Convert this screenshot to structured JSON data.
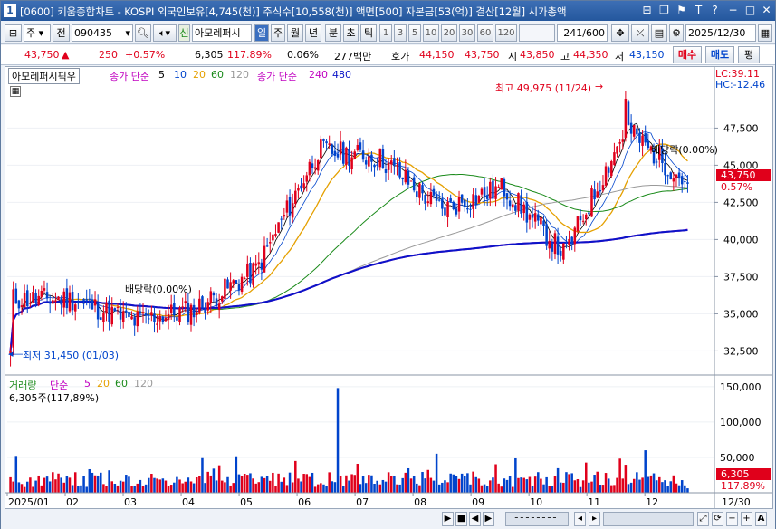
{
  "titlebar": {
    "window_number": "1",
    "title": "[0600] 키움종합차트 - KOSPI 외국인보유[4,745(천)] 주식수[10,558(천)] 액면[500] 자본금[53(억)] 결산[12월] 시가총액",
    "controls": [
      "⊟",
      "❐",
      "⚑",
      "T",
      "?",
      "−",
      "□",
      "✕"
    ]
  },
  "toolbar": {
    "market": "주",
    "all": "전",
    "code": "090435",
    "new_label": "신",
    "stock_name": "아모레퍼시",
    "period_tabs": [
      "일",
      "주",
      "월",
      "년",
      "분",
      "초",
      "틱"
    ],
    "active_period": "일",
    "intervals": [
      "1",
      "3",
      "5",
      "10",
      "20",
      "30",
      "60",
      "120"
    ],
    "count": "241",
    "count_total": "/600",
    "date": "2025/12/30"
  },
  "quote": {
    "price": "43,750",
    "arrow": "▲",
    "change": "250",
    "change_pct": "+0.57%",
    "volume": "6,305",
    "volume_ratio": "117.89%",
    "turnover": "0.06%",
    "amount": "277백만",
    "ask_label": "호가",
    "ask1": "44,150",
    "ask2": "43,750",
    "open_label": "시",
    "open": "43,850",
    "high_label": "고",
    "high": "44,350",
    "low_label": "저",
    "low": "43,150",
    "buy": "매수",
    "sell": "매도",
    "eval": "평"
  },
  "price_panel": {
    "stock_tag": "아모레퍼시픽우",
    "ma_label": "종가 단순",
    "ma_periods": [
      "5",
      "10",
      "20",
      "60",
      "120"
    ],
    "ma_label2": "종가 단순",
    "ma_periods2": [
      "240",
      "480"
    ],
    "lc": "LC:39.11",
    "hc": "HC:-12.46",
    "high_note": "최고 49,975 (11/24)",
    "low_note": "최저 31,450 (01/03)",
    "div_note1": "배당락(0.00%)",
    "div_note2": "배당락(0.00%)",
    "last_price": "43,750",
    "last_pct": "0.57%",
    "y_ticks": [
      "47,500",
      "45,000",
      "42,500",
      "40,000",
      "37,500",
      "35,000",
      "32,500"
    ]
  },
  "volume_panel": {
    "label": "거래량",
    "ma_label": "단순",
    "ma_periods": [
      "5",
      "20",
      "60",
      "120"
    ],
    "value_text": "6,305주(117,89%)",
    "y_ticks": [
      "150,000",
      "100,000",
      "50,000"
    ],
    "last_volume": "6,305",
    "last_pct": "117.89%"
  },
  "x_axis": {
    "labels": [
      "2025/01",
      "02",
      "03",
      "04",
      "05",
      "06",
      "07",
      "08",
      "09",
      "10",
      "11",
      "12"
    ],
    "end_label": "12/30"
  },
  "colors": {
    "up": "#e0001b",
    "down": "#0044cc",
    "ma5": "#000000",
    "ma10": "#0044cc",
    "ma20": "#e5a000",
    "ma60": "#1a8a1a",
    "ma120": "#9a9a9a",
    "ma240": "#c000c0",
    "ma480": "#0a14c8"
  },
  "chart_data": {
    "type": "candlestick",
    "price_range": [
      31000,
      51000
    ],
    "volume_range": [
      0,
      160000
    ],
    "months": [
      "2025/01",
      "02",
      "03",
      "04",
      "05",
      "06",
      "07",
      "08",
      "09",
      "10",
      "11",
      "12"
    ],
    "monthly_closes_approx": [
      36000,
      36000,
      34500,
      35300,
      38000,
      46000,
      45500,
      42000,
      43500,
      39000,
      47500,
      43750
    ],
    "high": {
      "value": 49975,
      "date": "11/24"
    },
    "low": {
      "value": 31450,
      "date": "01/03"
    },
    "last": {
      "close": 43750,
      "open": 43850,
      "high": 44350,
      "low": 43150,
      "volume": 6305
    }
  }
}
